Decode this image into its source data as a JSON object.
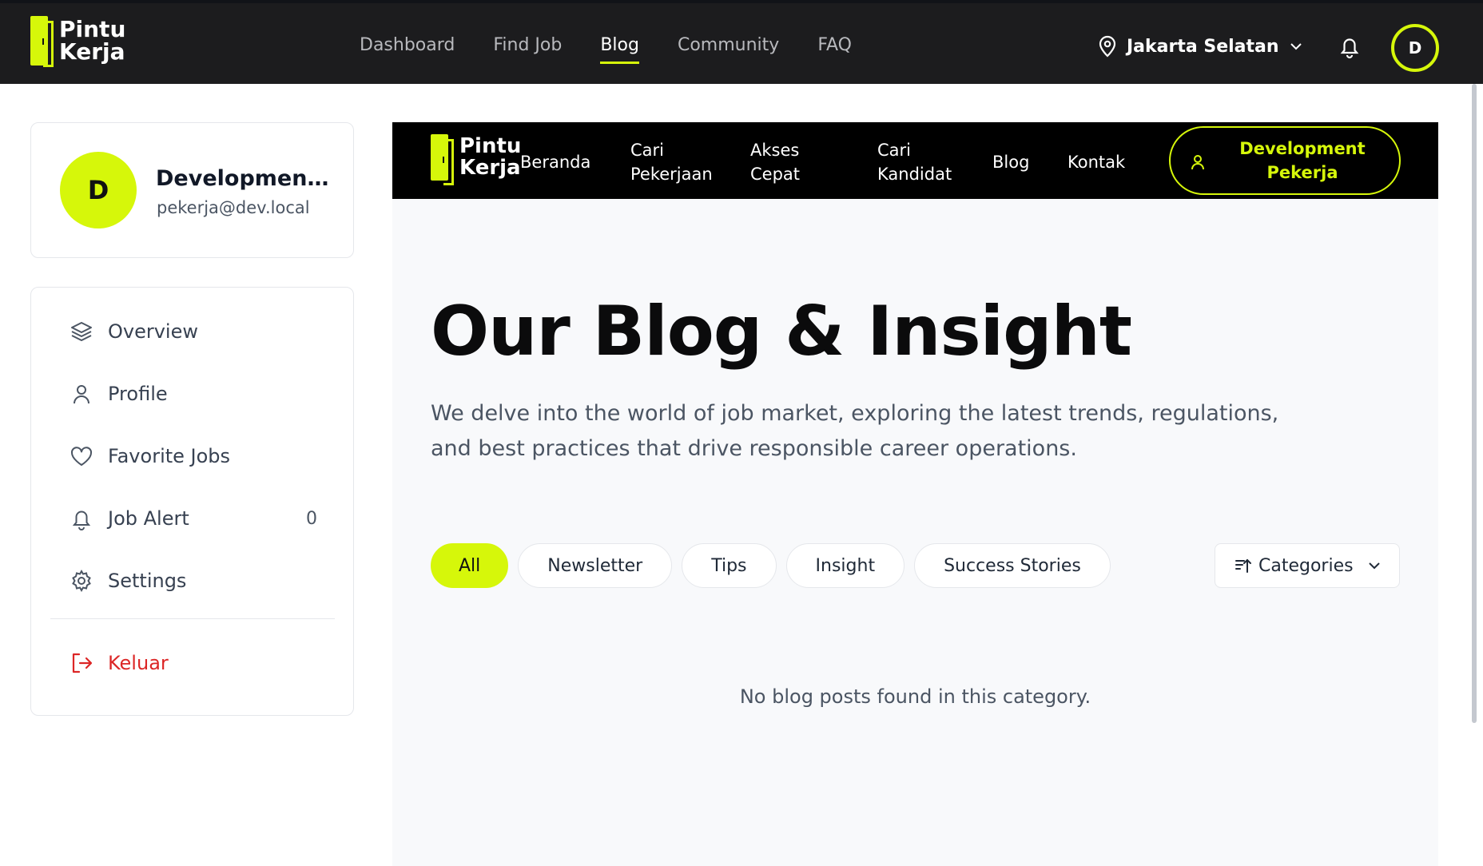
{
  "topbar": {
    "logo": {
      "line1": "Pintu",
      "line2": "Kerja"
    },
    "nav": [
      {
        "label": "Dashboard",
        "active": false
      },
      {
        "label": "Find Job",
        "active": false
      },
      {
        "label": "Blog",
        "active": true
      },
      {
        "label": "Community",
        "active": false
      },
      {
        "label": "FAQ",
        "active": false
      }
    ],
    "location": "Jakarta Selatan",
    "avatar_initial": "D"
  },
  "sidebar": {
    "profile": {
      "initial": "D",
      "name": "Development Pekerja",
      "email": "pekerja@dev.local"
    },
    "menu": [
      {
        "label": "Overview",
        "icon": "layers-icon"
      },
      {
        "label": "Profile",
        "icon": "user-icon"
      },
      {
        "label": "Favorite Jobs",
        "icon": "heart-icon"
      },
      {
        "label": "Job Alert",
        "icon": "bell-icon",
        "count": "0"
      },
      {
        "label": "Settings",
        "icon": "gear-icon"
      }
    ],
    "logout_label": "Keluar"
  },
  "site": {
    "logo": {
      "line1": "Pintu",
      "line2": "Kerja"
    },
    "nav": [
      {
        "label": "Beranda"
      },
      {
        "label": "Cari Pekerjaan"
      },
      {
        "label": "Akses Cepat"
      },
      {
        "label": "Cari Kandidat"
      },
      {
        "label": "Blog"
      },
      {
        "label": "Kontak"
      }
    ],
    "user_button": "Development Pekerja"
  },
  "hero": {
    "title": "Our Blog & Insight",
    "description": "We delve into the world of job market, exploring the latest trends, regulations, and best practices that drive responsible career operations."
  },
  "filters": {
    "chips": [
      {
        "label": "All",
        "active": true
      },
      {
        "label": "Newsletter",
        "active": false
      },
      {
        "label": "Tips",
        "active": false
      },
      {
        "label": "Insight",
        "active": false
      },
      {
        "label": "Success Stories",
        "active": false
      }
    ],
    "categories_label": "Categories"
  },
  "empty_message": "No blog posts found in this category.",
  "colors": {
    "accent": "#d6f70a",
    "dark": "#1c1c1e",
    "danger": "#dc2626"
  }
}
